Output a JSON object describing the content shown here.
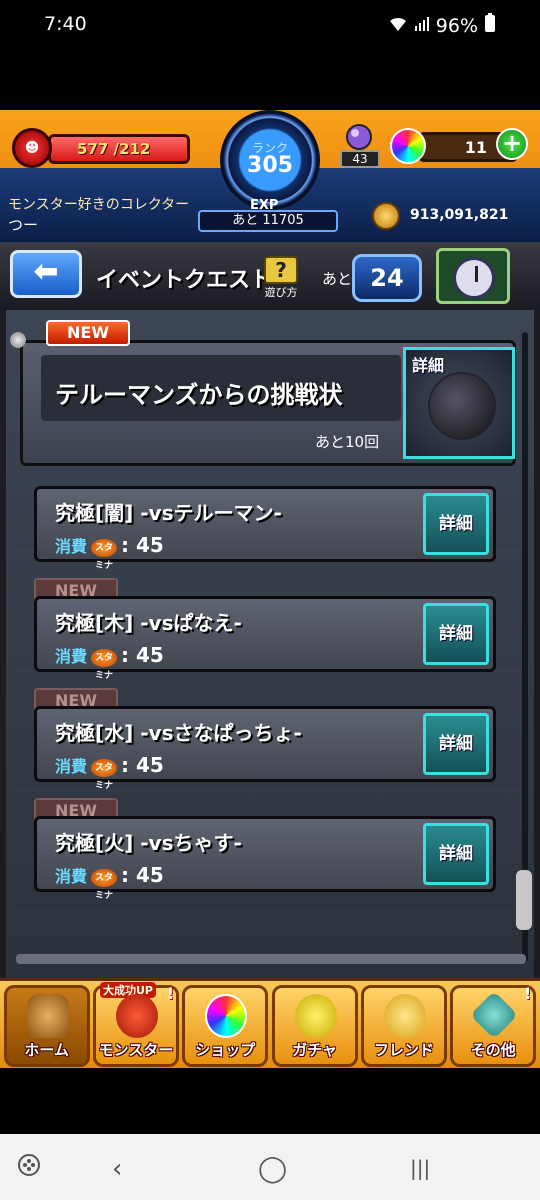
{
  "status_bar": {
    "time": "7:40",
    "battery": "96%"
  },
  "hud": {
    "stamina_text": "577 /212",
    "stamina_fill": 1.0,
    "rank_label": "ランク",
    "rank_value": "305",
    "exp_label": "EXP",
    "exp_remaining": "あと 11705",
    "gem_count": "43",
    "orb_count": "11",
    "orb_plus": "+",
    "player_title": "モンスター好きのコレクター",
    "player_name": "つー",
    "coins": "913,091,821"
  },
  "header": {
    "back_label": "⬅",
    "title": "イベントクエスト",
    "help_icon": "?",
    "help_label": "遊び方",
    "remaining_prefix": "あと",
    "event_count": "24"
  },
  "featured": {
    "badge": "NEW",
    "title": "テルーマンズからの挑戦状",
    "remaining": "あと10回",
    "detail_label": "詳細"
  },
  "quests": [
    {
      "badge": "",
      "name": "究極[闇] -vsテルーマン-",
      "cost_label": "消費",
      "stamina_icon": "スタミナ",
      "cost_value": ": 45",
      "detail_label": "詳細"
    },
    {
      "badge": "NEW",
      "name": "究極[木] -vsぱなえ-",
      "cost_label": "消費",
      "stamina_icon": "スタミナ",
      "cost_value": ": 45",
      "detail_label": "詳細"
    },
    {
      "badge": "NEW",
      "name": "究極[水] -vsさなぱっちょ-",
      "cost_label": "消費",
      "stamina_icon": "スタミナ",
      "cost_value": ": 45",
      "detail_label": "詳細"
    },
    {
      "badge": "NEW",
      "name": "究極[火] -vsちゃす-",
      "cost_label": "消費",
      "stamina_icon": "スタミナ",
      "cost_value": ": 45",
      "detail_label": "詳細"
    }
  ],
  "bottom_nav": [
    {
      "label": "ホーム",
      "icon": "home-icon"
    },
    {
      "label": "モンスター",
      "icon": "monster-icon",
      "tag": "大成功UP"
    },
    {
      "label": "ショップ",
      "icon": "shop-orb-icon"
    },
    {
      "label": "ガチャ",
      "icon": "gacha-icon"
    },
    {
      "label": "フレンド",
      "icon": "friend-icon"
    },
    {
      "label": "その他",
      "icon": "other-icon"
    }
  ],
  "system_nav": {
    "recents": "|||",
    "home": "◯",
    "back": "‹"
  }
}
